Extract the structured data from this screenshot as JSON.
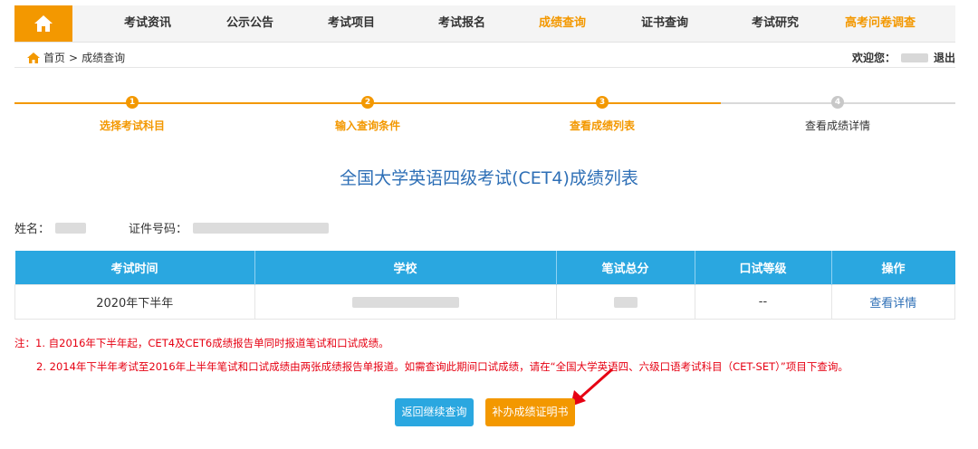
{
  "nav": {
    "items": [
      {
        "label": "考试资讯"
      },
      {
        "label": "公示公告"
      },
      {
        "label": "考试项目"
      },
      {
        "label": "考试报名"
      },
      {
        "label": "成绩查询"
      },
      {
        "label": "证书查询"
      },
      {
        "label": "考试研究"
      },
      {
        "label": "高考问卷调查"
      }
    ],
    "active_index": 4
  },
  "breadcrumb": {
    "home": "首页",
    "separator": ">",
    "current": "成绩查询"
  },
  "user": {
    "welcome": "欢迎您：",
    "logout": "退出"
  },
  "steps": [
    {
      "num": "1",
      "label": "选择考试科目"
    },
    {
      "num": "2",
      "label": "输入查询条件"
    },
    {
      "num": "3",
      "label": "查看成绩列表"
    },
    {
      "num": "4",
      "label": "查看成绩详情"
    }
  ],
  "steps_completed": 3,
  "title": "全国大学英语四级考试(CET4)成绩列表",
  "person": {
    "name_label": "姓名：",
    "id_label": "证件号码："
  },
  "table": {
    "headers": [
      "考试时间",
      "学校",
      "笔试总分",
      "口试等级",
      "操作"
    ],
    "rows": [
      {
        "time": "2020年下半年",
        "oral": "--",
        "action": "查看详情"
      }
    ]
  },
  "notes": {
    "line1": "注：1. 自2016年下半年起，CET4及CET6成绩报告单同时报道笔试和口试成绩。",
    "line2": "2. 2014年下半年考试至2016年上半年笔试和口试成绩由两张成绩报告单报道。如需查询此期间口试成绩，请在“全国大学英语四、六级口语考试科目（CET-SET）”项目下查询。"
  },
  "buttons": {
    "back": "返回继续查询",
    "certificate": "补办成绩证明书"
  },
  "colors": {
    "accent_orange": "#f39800",
    "header_blue": "#2aa7e0",
    "title_blue": "#2e6fb6",
    "note_red": "#e60012"
  }
}
